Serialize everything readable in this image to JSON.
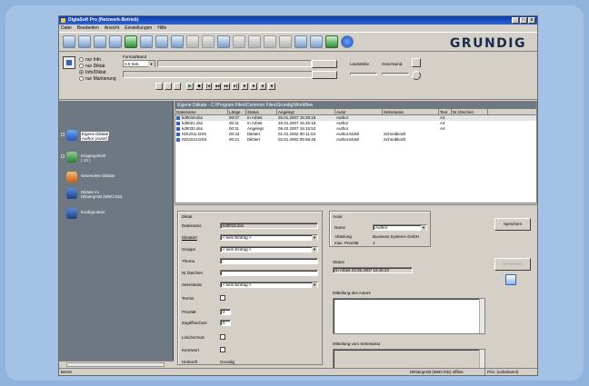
{
  "window": {
    "title": "DigtaSoft Pro (Netzwerk-Betrieb)"
  },
  "menu": [
    "Datei",
    "Bearbeiten",
    "Ansicht",
    "Einstellungen",
    "Hilfe"
  ],
  "brand": "GRUNDIG",
  "recorder": {
    "modes": [
      {
        "label": "nur Info",
        "selected": false
      },
      {
        "label": "nur Diktat",
        "selected": false
      },
      {
        "label": "Info/Diktat",
        "selected": true
      },
      {
        "label": "nur Markierung",
        "selected": false
      }
    ],
    "format_label": "Format/Band",
    "position_value": "0.0 Sek.",
    "lautst_label": "Lautstärke",
    "geschw_label": "Geschwind."
  },
  "sidebar": {
    "items": [
      {
        "label": "Eigene Diktate",
        "sub": "Author (Autor)",
        "selected": true
      },
      {
        "label": "Eingangskorb",
        "sub": "( 13 )",
        "selected": false
      },
      {
        "label": "Gesendete Diktate",
        "sub": "",
        "selected": false
      },
      {
        "label": "Diktate im",
        "sub": "Diktiergerät (MMC/SD)",
        "selected": false
      },
      {
        "label": "Konfiguration",
        "sub": "",
        "selected": false
      }
    ]
  },
  "files": {
    "path": "Eigene Diktate - C:\\Program Files\\Common Files\\Grundig\\Workflow",
    "columns": [
      "Dateiname",
      "Länge",
      "Status",
      "Angelegt",
      "Autor",
      "Sekretariat",
      "Text",
      "Nr./Zeichen"
    ],
    "rows": [
      [
        "kd0018.dss",
        "00:07",
        "In Arbeit",
        "25.01.2007  15:38:18",
        "Author",
        "",
        "A4",
        ""
      ],
      [
        "kd0021.dss",
        "00:11",
        "In Arbeit",
        "26.01.2007  15:46:16",
        "Author",
        "",
        "A4",
        ""
      ],
      [
        "kd0032.dss",
        "00:11",
        "Angelegt",
        "09.02.2007  16:15:52",
        "Author",
        "",
        "A4",
        ""
      ],
      [
        "KDU011.DSS",
        "00:33",
        "Diktiert",
        "01.01.2002  00:11:04",
        "Author.Mobil",
        "Schreibkraft",
        "",
        ""
      ],
      [
        "KDU013.DSS",
        "00:21",
        "Diktiert",
        "02.01.2002  05:58:45",
        "Author.Mobil",
        "Schreibkraft",
        "",
        ""
      ]
    ]
  },
  "details": {
    "group_label": "Diktat",
    "dateiname_label": "Dateiname",
    "dateiname_value": "kd0018.dss",
    "diktatart_label": "Diktatart",
    "diktatart_value": "< kein Eintrag >",
    "gruppe_label": "Gruppe",
    "gruppe_value": "< kein Eintrag >",
    "thema_label": "Thema",
    "nr_label": "Nr./Zeichen",
    "sekretariat_label": "Sekretariat",
    "sekretariat_value": "< kein Eintrag >",
    "termin_label": "Termin",
    "prioritat_label": "Priorität",
    "prioritat_value": "4",
    "zugriff_label": "Zugriffsschutz",
    "zugriff_value": "0",
    "loeschschutz_label": "Löschschutz",
    "kennwort_label": "Kennwort",
    "herkunft_label": "Herkunft",
    "herkunft_value": "Grundig",
    "autor_group": "Autor",
    "name_label": "Name",
    "name_value": "Author",
    "abteilung_label": "Abteilung",
    "abteilung_value": "Business Systems GmbH",
    "max_prio_label": "max. Priorität",
    "max_prio_value": "1",
    "status_group": "Status",
    "status_value": "In Arbeit  03.05.2007  16:46:22",
    "mitteilung_autor": "Mitteilung des Autors",
    "mitteilung_sek": "Mitteilung vom Sekretariat",
    "save_label": "Speichern",
    "send_label": "Versenden"
  },
  "status_bar": {
    "left": "Bereit",
    "device": "Diktiergerät (MMC/SD) offline",
    "prio": "Prio: (unbekannt)"
  }
}
